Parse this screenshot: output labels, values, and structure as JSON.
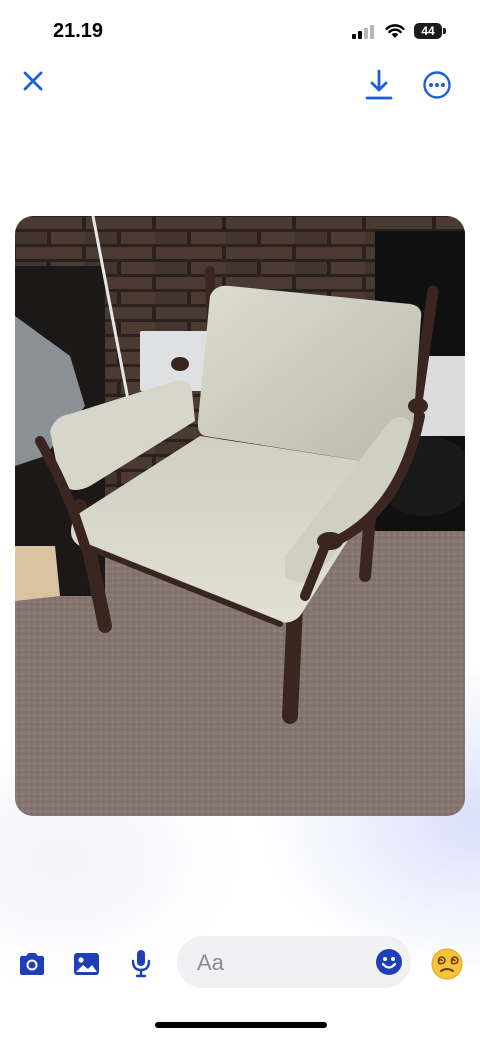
{
  "status_bar": {
    "time": "21.19",
    "battery": "44"
  },
  "toolbar": {
    "close_icon": "close-icon",
    "download_icon": "download-icon",
    "more_icon": "more-options-icon",
    "accent_color": "#1a5fe0"
  },
  "photo": {
    "subject": "armchair-photo"
  },
  "composer": {
    "camera_icon": "camera-icon",
    "gallery_icon": "image-icon",
    "mic_icon": "microphone-icon",
    "placeholder": "Aa",
    "emoji_icon": "smiley-icon",
    "reaction_icon": "dizzy-face-emoji",
    "icon_color": "#1e3fb8"
  }
}
